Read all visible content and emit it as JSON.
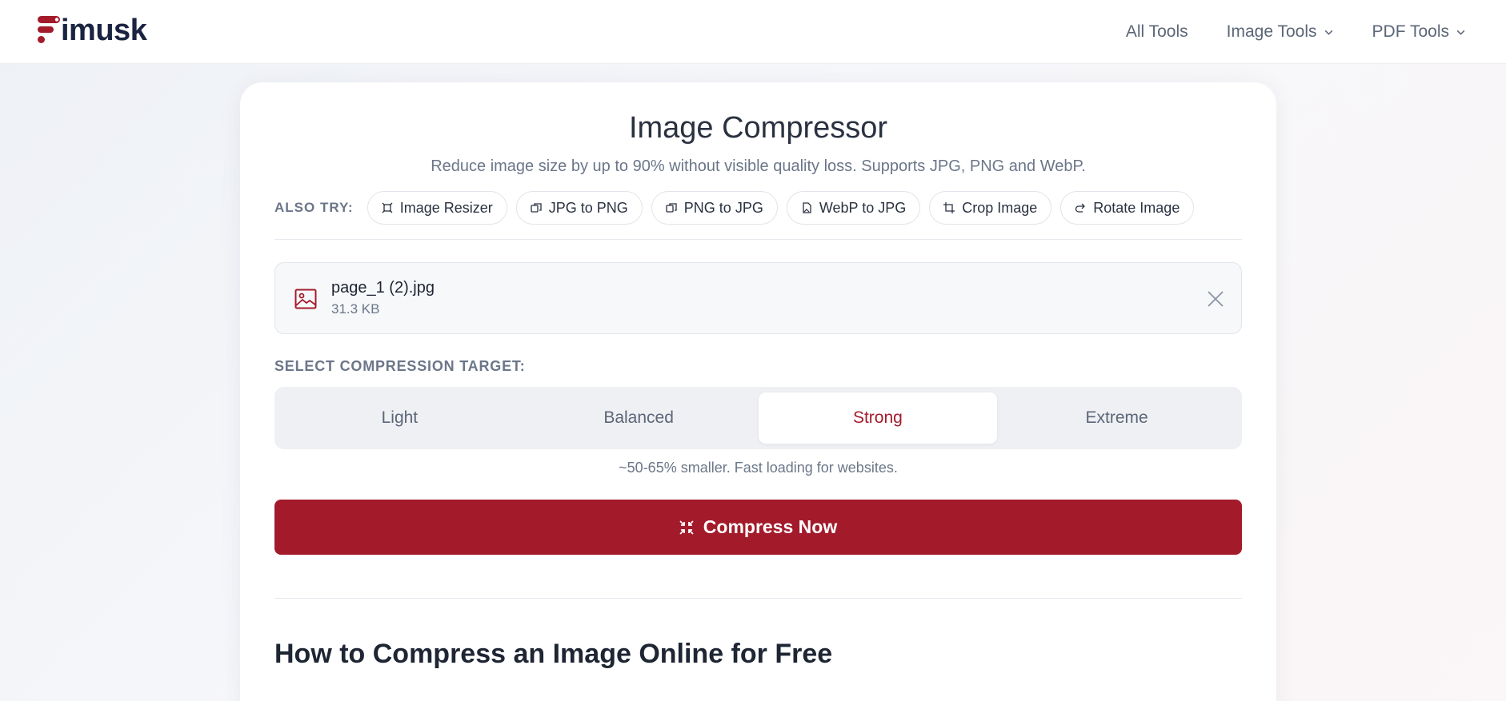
{
  "brand": {
    "name": "imusk",
    "accent": "#a31b2b"
  },
  "nav": [
    {
      "label": "All Tools"
    },
    {
      "label": "Image Tools"
    },
    {
      "label": "PDF Tools"
    }
  ],
  "tool": {
    "title": "Image Compressor",
    "subtitle": "Reduce image size by up to 90% without visible quality loss. Supports JPG, PNG and WebP."
  },
  "also_try": {
    "label": "ALSO TRY:",
    "items": [
      {
        "label": "Image Resizer",
        "icon": "resize-icon"
      },
      {
        "label": "JPG to PNG",
        "icon": "convert-icon"
      },
      {
        "label": "PNG to JPG",
        "icon": "convert-icon"
      },
      {
        "label": "WebP to JPG",
        "icon": "file-image-icon"
      },
      {
        "label": "Crop Image",
        "icon": "crop-icon"
      },
      {
        "label": "Rotate Image",
        "icon": "rotate-icon"
      }
    ]
  },
  "file": {
    "name": "page_1 (2).jpg",
    "size": "31.3 KB"
  },
  "compression": {
    "label": "SELECT COMPRESSION TARGET:",
    "options": [
      {
        "label": "Light"
      },
      {
        "label": "Balanced"
      },
      {
        "label": "Strong"
      },
      {
        "label": "Extreme"
      }
    ],
    "selected": "Strong",
    "hint": "~50-65% smaller. Fast loading for websites."
  },
  "action": {
    "label": "Compress Now"
  },
  "howto": {
    "title": "How to Compress an Image Online for Free"
  }
}
